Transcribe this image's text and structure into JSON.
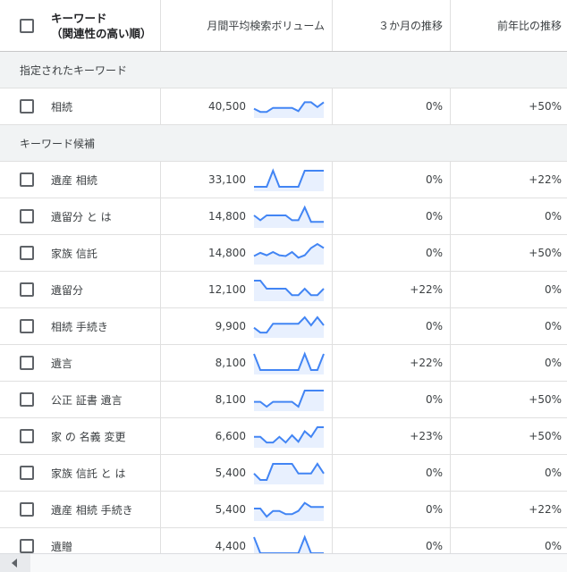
{
  "header": {
    "keyword_title": "キーワード",
    "keyword_sub": "（関連性の高い順）",
    "volume": "月間平均検索ボリューム",
    "three_month": "３か月の推移",
    "yoy": "前年比の推移"
  },
  "sections": {
    "specified": "指定されたキーワード",
    "candidates": "キーワード候補"
  },
  "colors": {
    "trend_line": "#4285f4",
    "trend_fill": "#e8f0fe"
  },
  "rows": [
    {
      "keyword": "相続",
      "volume": "40,500",
      "three_month": "0%",
      "yoy": "+50%",
      "trend": [
        0.3,
        0.1,
        0.1,
        0.35,
        0.35,
        0.35,
        0.35,
        0.15,
        0.7,
        0.7,
        0.4,
        0.7
      ]
    },
    {
      "keyword": "遺産 相続",
      "volume": "33,100",
      "three_month": "0%",
      "yoy": "+22%",
      "trend": [
        0,
        0,
        0,
        1,
        0,
        0,
        0,
        0,
        1,
        1,
        1,
        1
      ]
    },
    {
      "keyword": "遺留分 と は",
      "volume": "14,800",
      "three_month": "0%",
      "yoy": "0%",
      "trend": [
        0.5,
        0.2,
        0.5,
        0.5,
        0.5,
        0.5,
        0.2,
        0.2,
        1,
        0.1,
        0.1,
        0.1
      ]
    },
    {
      "keyword": "家族 信託",
      "volume": "14,800",
      "three_month": "0%",
      "yoy": "+50%",
      "trend": [
        0.25,
        0.45,
        0.3,
        0.5,
        0.3,
        0.25,
        0.5,
        0.15,
        0.3,
        0.75,
        1,
        0.75
      ]
    },
    {
      "keyword": "遺留分",
      "volume": "12,100",
      "three_month": "+22%",
      "yoy": "0%",
      "trend": [
        1,
        1,
        0.5,
        0.5,
        0.5,
        0.5,
        0.1,
        0.1,
        0.5,
        0.1,
        0.1,
        0.5
      ]
    },
    {
      "keyword": "相続 手続き",
      "volume": "9,900",
      "three_month": "0%",
      "yoy": "0%",
      "trend": [
        0.35,
        0.05,
        0.05,
        0.6,
        0.6,
        0.6,
        0.6,
        0.6,
        1,
        0.5,
        1,
        0.5
      ]
    },
    {
      "keyword": "遺言",
      "volume": "8,100",
      "three_month": "+22%",
      "yoy": "0%",
      "trend": [
        1,
        0,
        0,
        0,
        0,
        0,
        0,
        0,
        1,
        0,
        0,
        1
      ]
    },
    {
      "keyword": "公正 証書 遺言",
      "volume": "8,100",
      "three_month": "0%",
      "yoy": "+50%",
      "trend": [
        0.3,
        0.3,
        0,
        0.3,
        0.3,
        0.3,
        0.3,
        0,
        1,
        1,
        1,
        1
      ]
    },
    {
      "keyword": "家 の 名義 変更",
      "volume": "6,600",
      "three_month": "+23%",
      "yoy": "+50%",
      "trend": [
        0.4,
        0.4,
        0.05,
        0.05,
        0.4,
        0.05,
        0.5,
        0.1,
        0.75,
        0.4,
        1,
        1
      ]
    },
    {
      "keyword": "家族 信託 と は",
      "volume": "5,400",
      "three_month": "0%",
      "yoy": "0%",
      "trend": [
        0.4,
        0,
        0,
        1,
        1,
        1,
        1,
        0.4,
        0.4,
        0.4,
        1,
        0.4
      ]
    },
    {
      "keyword": "遺産 相続 手続き",
      "volume": "5,400",
      "three_month": "0%",
      "yoy": "+22%",
      "trend": [
        0.5,
        0.5,
        0,
        0.35,
        0.35,
        0.15,
        0.15,
        0.35,
        0.85,
        0.6,
        0.6,
        0.6
      ]
    },
    {
      "keyword": "遺贈",
      "volume": "4,400",
      "three_month": "0%",
      "yoy": "0%",
      "trend": [
        1,
        0,
        0,
        0,
        0,
        0,
        0,
        0,
        1,
        0,
        0,
        0
      ]
    }
  ]
}
